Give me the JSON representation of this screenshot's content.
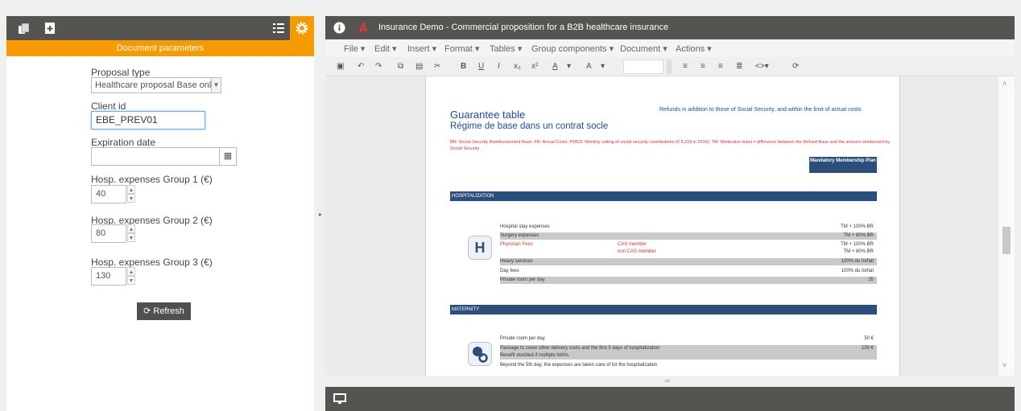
{
  "left_panel": {
    "header": "Document parameters",
    "fields": {
      "proposal_type_label": "Proposal type",
      "proposal_type_value": "Healthcare proposal Base only",
      "client_id_label": "Client id",
      "client_id_value": "EBE_PREV01",
      "expiration_date_label": "Expiration date",
      "expiration_date_value": "",
      "hosp1_label": "Hosp. expenses Group 1 (€)",
      "hosp1_value": "40",
      "hosp2_label": "Hosp. expenses Group 2 (€)",
      "hosp2_value": "80",
      "hosp3_label": "Hosp. expenses Group 3 (€)",
      "hosp3_value": "130"
    },
    "refresh_label": "Refresh"
  },
  "main": {
    "title": "Insurance Demo - Commercial proposition for a B2B healthcare insurance",
    "menu": [
      "File",
      "Edit",
      "Insert",
      "Format",
      "Tables",
      "Group components",
      "Document",
      "Actions"
    ],
    "toolbar": [
      "B",
      "U",
      "I",
      "x₂",
      "x²",
      "A",
      "A"
    ],
    "document": {
      "heading1": "Guarantee table",
      "heading2": "Régime de base dans un contrat socle",
      "note_right": "Refunds in addition to those of Social Security, and within the limit of actual costs",
      "footnote": "BR: Social Security Reimbursement Base; FR: Actual Costs; PMSS: Monthly ceiling of social security contributions (€ 3,218 in 2016); TM: Moderator ticket = difference between the Refund Base and the amount reimbursed by Social Security",
      "plan_header": "Mandatory Membership Plan",
      "section_hosp": "HOSPITALIZATION",
      "section_maternity": "MATERNITY",
      "hosp_letter": "H",
      "hosp_rows": [
        {
          "label": "Hospital stay expenses",
          "mid": "",
          "value": "TM + 100% BR"
        },
        {
          "label": "Surgery expenses",
          "mid": "",
          "value": "TM + 80% BR"
        },
        {
          "label": "Physician Fees",
          "mid": "CAS member",
          "value": "TM + 100% BR"
        },
        {
          "label": "",
          "mid": "non CAS member",
          "value": "TM + 80% BR"
        },
        {
          "label": "Heavy services",
          "mid": "",
          "value": "100% du forfait"
        },
        {
          "label": "Day fees",
          "mid": "",
          "value": "100% du forfait"
        },
        {
          "label": "Private room per day",
          "mid": "",
          "value": "35"
        }
      ],
      "mat_rows": [
        {
          "label": "Private room per day",
          "value": "50 €"
        },
        {
          "label": "Package to cover other delivery costs and the first 5 days of hospitalization",
          "value": "100 €"
        },
        {
          "label": "Benefit doubled if multiple births.",
          "value": ""
        },
        {
          "label": "Beyond the 5th day, the expenses are taken care of for the hospitalization",
          "value": ""
        }
      ]
    }
  },
  "colors": {
    "accent_orange": "#f59a00",
    "dark_bar": "#555450",
    "doc_blue": "#1a4c9b",
    "section_bar": "#2b4f7d"
  }
}
